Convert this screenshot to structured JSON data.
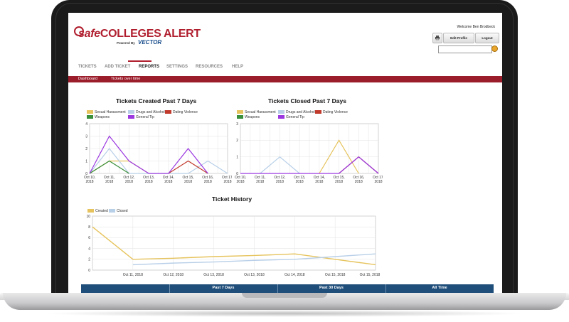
{
  "brand": {
    "safe": "safe",
    "colleges": "COLLEGES",
    "alert": "ALERT",
    "powered_by": "Powered By",
    "vector": "VECTOR",
    "accent_color": "#b01e2e"
  },
  "header": {
    "welcome": "Welcome Ben Brodbeck",
    "print_icon": "print-icon",
    "edit_profile": "Edit Profile",
    "logout": "Logout",
    "search_placeholder": ""
  },
  "nav": {
    "items": [
      {
        "label": "TICKETS",
        "active": false
      },
      {
        "label": "ADD TICKET",
        "active": false
      },
      {
        "label": "REPORTS",
        "active": true
      },
      {
        "label": "SETTINGS",
        "active": false
      },
      {
        "label": "RESOURCES",
        "active": false
      },
      {
        "label": "HELP",
        "active": false
      }
    ]
  },
  "subnav": {
    "items": [
      "Dashboard",
      "Tickets over time"
    ]
  },
  "table": {
    "headers": [
      "",
      "Past 7 Days",
      "Past 30 Days",
      "All Time"
    ]
  },
  "chart_data": [
    {
      "type": "line",
      "title": "Tickets Created Past 7 Days",
      "categories": [
        "Oct 10, 2018",
        "Oct 11, 2018",
        "Oct 12, 2018",
        "Oct 13, 2018",
        "Oct 14, 2018",
        "Oct 15, 2018",
        "Oct 16, 2018",
        "Oct 17, 2018"
      ],
      "x_ticks": [
        0,
        0.5,
        1,
        1.5,
        2,
        2.5,
        3,
        3.5,
        4,
        4.5,
        5,
        5.5,
        6,
        6.5,
        7
      ],
      "ylim": [
        0,
        4
      ],
      "yticks": [
        0,
        1,
        2,
        3,
        4
      ],
      "legend_placement": "top-left",
      "series": [
        {
          "name": "Sexual Harassment",
          "color": "#e6c35c",
          "points": [
            [
              0,
              0
            ],
            [
              1,
              1
            ],
            [
              2,
              1
            ],
            [
              3,
              0
            ]
          ]
        },
        {
          "name": "Drugs and Alcohol",
          "color": "#b8cfe8",
          "points": [
            [
              0,
              0
            ],
            [
              1,
              2
            ],
            [
              2,
              0
            ],
            [
              3,
              0
            ],
            [
              5,
              0
            ],
            [
              6,
              1
            ],
            [
              7,
              0
            ]
          ]
        },
        {
          "name": "Dating Violence",
          "color": "#c0392b",
          "points": [
            [
              4,
              0
            ],
            [
              5,
              1
            ],
            [
              6,
              0
            ]
          ]
        },
        {
          "name": "Weapons",
          "color": "#3a8f3a",
          "points": [
            [
              0,
              0
            ],
            [
              1,
              1
            ],
            [
              2,
              0
            ]
          ]
        },
        {
          "name": "General Tip",
          "color": "#9b38e0",
          "points": [
            [
              0,
              0
            ],
            [
              1,
              3
            ],
            [
              2,
              1
            ],
            [
              3,
              0
            ],
            [
              4,
              0
            ],
            [
              5,
              2
            ],
            [
              6,
              0
            ]
          ]
        }
      ]
    },
    {
      "type": "line",
      "title": "Tickets Closed Past 7 Days",
      "categories": [
        "Oct 10, 2018",
        "Oct 11, 2018",
        "Oct 12, 2018",
        "Oct 13, 2018",
        "Oct 14, 2018",
        "Oct 15, 2018",
        "Oct 16, 2018",
        "Oct 17, 2018"
      ],
      "ylim": [
        0,
        3
      ],
      "yticks": [
        0,
        1,
        2,
        3
      ],
      "legend_placement": "top-left",
      "series": [
        {
          "name": "Sexual Harassment",
          "color": "#e6c35c",
          "points": [
            [
              4,
              0
            ],
            [
              5,
              2
            ],
            [
              6,
              0
            ]
          ]
        },
        {
          "name": "Drugs and Alcohol",
          "color": "#b8cfe8",
          "points": [
            [
              1,
              0
            ],
            [
              2,
              1
            ],
            [
              3,
              0
            ]
          ]
        },
        {
          "name": "Dating Violence",
          "color": "#c0392b",
          "points": [
            [
              5,
              0
            ],
            [
              6,
              1
            ],
            [
              7,
              0
            ]
          ]
        },
        {
          "name": "Weapons",
          "color": "#3a8f3a",
          "points": []
        },
        {
          "name": "General Tip",
          "color": "#9b38e0",
          "points": [
            [
              0,
              0
            ],
            [
              5,
              0
            ],
            [
              6,
              1
            ],
            [
              7,
              0
            ]
          ]
        }
      ]
    },
    {
      "type": "line",
      "title": "Ticket History",
      "categories": [
        "Oct 11, 2018",
        "Oct 11, 2018",
        "Oct 12, 2018",
        "Oct 13, 2018",
        "Oct 13, 2018",
        "Oct 14, 2018",
        "Oct 15, 2018",
        "Oct 15, 2018"
      ],
      "ylim": [
        0,
        10
      ],
      "yticks": [
        0,
        2,
        4,
        6,
        8,
        10
      ],
      "legend_placement": "top-left",
      "series": [
        {
          "name": "Created",
          "color": "#e6c35c",
          "values": [
            8,
            2,
            2.2,
            2.5,
            2.7,
            3,
            2,
            1
          ]
        },
        {
          "name": "Closed",
          "color": "#b8cfe8",
          "values": [
            null,
            1,
            1.3,
            1.5,
            1.8,
            2,
            2.5,
            3
          ]
        }
      ]
    }
  ]
}
